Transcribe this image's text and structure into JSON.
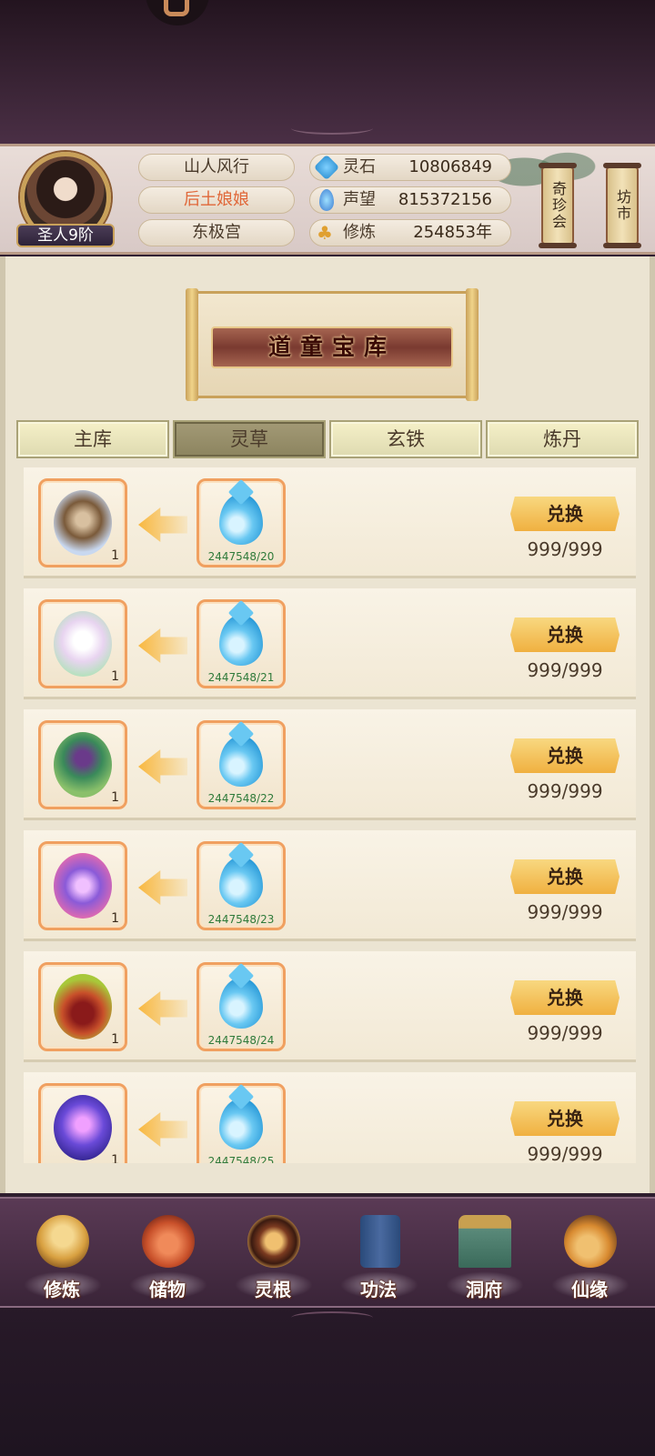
{
  "player": {
    "name": "山人风行",
    "title": "后土娘娘",
    "faction": "东极宫",
    "rank": "圣人9阶"
  },
  "stats": [
    {
      "icon": "spirit-stone-icon",
      "label": "灵石",
      "value": "10806849"
    },
    {
      "icon": "reputation-icon",
      "label": "声望",
      "value": "815372156"
    },
    {
      "icon": "meditation-icon",
      "label": "修炼",
      "value": "254853年"
    }
  ],
  "side_buttons": {
    "treasure_fair": "奇珍会",
    "market": "坊市"
  },
  "vault": {
    "title": "道童宝库",
    "tabs": [
      "主库",
      "灵草",
      "玄铁",
      "炼丹"
    ],
    "active_tab": "灵草",
    "items": [
      {
        "item_icon": "herb-root-icon",
        "item_qty": "1",
        "cost_icon": "spirit-water-icon",
        "cost": "2447548/20",
        "button": "兑换",
        "stock": "999/999",
        "color": "#7a5a3a"
      },
      {
        "item_icon": "lily-flower-icon",
        "item_qty": "1",
        "cost_icon": "spirit-water-icon",
        "cost": "2447548/21",
        "button": "兑换",
        "stock": "999/999",
        "color": "#e8d4f0"
      },
      {
        "item_icon": "peacock-feather-icon",
        "item_qty": "1",
        "cost_icon": "spirit-water-icon",
        "cost": "2447548/22",
        "button": "兑换",
        "stock": "999/999",
        "color": "#3a8a5a"
      },
      {
        "item_icon": "crystal-flower-icon",
        "item_qty": "1",
        "cost_icon": "spirit-water-icon",
        "cost": "2447548/23",
        "button": "兑换",
        "stock": "999/999",
        "color": "#8a5ad8"
      },
      {
        "item_icon": "berry-fruit-icon",
        "item_qty": "1",
        "cost_icon": "spirit-water-icon",
        "cost": "2447548/24",
        "button": "兑换",
        "stock": "999/999",
        "color": "#c8502a"
      },
      {
        "item_icon": "purple-lotus-icon",
        "item_qty": "1",
        "cost_icon": "spirit-water-icon",
        "cost": "2447548/25",
        "button": "兑换",
        "stock": "999/999",
        "color": "#6a4ad8"
      }
    ]
  },
  "bottom_nav": [
    {
      "icon": "cultivation-icon",
      "label": "修炼",
      "color": "#d8a040"
    },
    {
      "icon": "storage-bag-icon",
      "label": "储物",
      "color": "#c8502a"
    },
    {
      "icon": "spirit-root-icon",
      "label": "灵根",
      "color": "#7a3a20"
    },
    {
      "icon": "technique-book-icon",
      "label": "功法",
      "color": "#4a6aa0"
    },
    {
      "icon": "cave-mansion-icon",
      "label": "洞府",
      "color": "#5a8a7a"
    },
    {
      "icon": "fate-gourd-icon",
      "label": "仙缘",
      "color": "#d88a30"
    }
  ]
}
